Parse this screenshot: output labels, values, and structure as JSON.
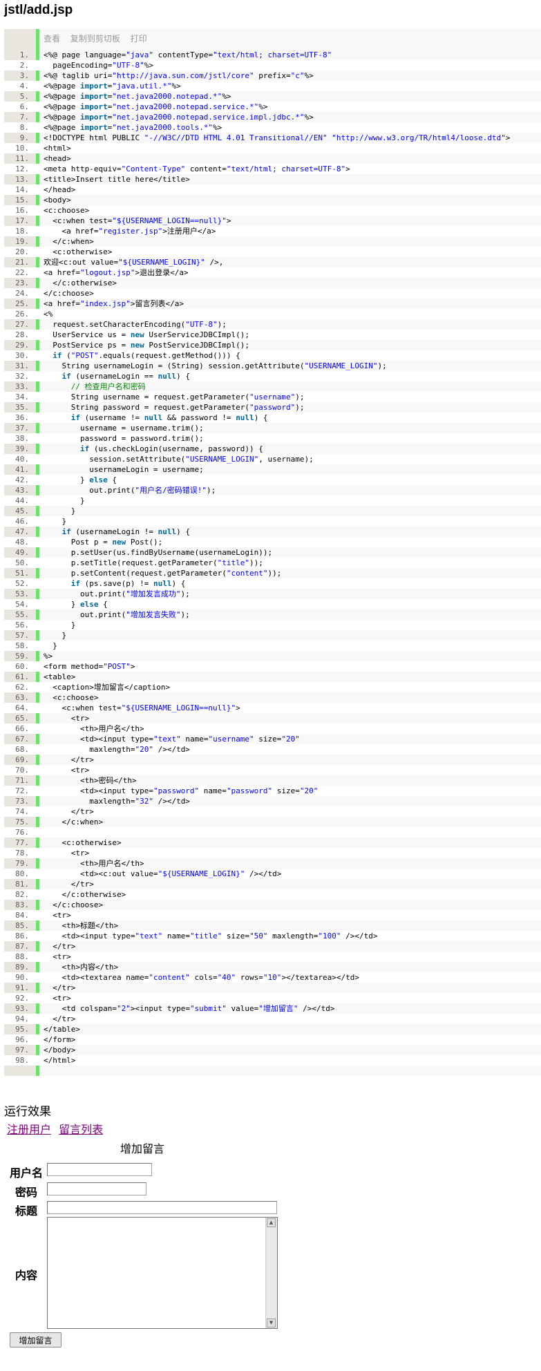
{
  "page_title": "jstl/add.jsp",
  "toolbar": {
    "view": "查看",
    "copy": "复制到剪切板",
    "print": "打印"
  },
  "code_lines": [
    "<%@ page language=\"java\" contentType=\"text/html; charset=UTF-8\"",
    "  pageEncoding=\"UTF-8\"%>",
    "<%@ taglib uri=\"http://java.sun.com/jstl/core\" prefix=\"c\"%>",
    "<%@page import=\"java.util.*\"%>",
    "<%@page import=\"net.java2000.notepad.*\"%>",
    "<%@page import=\"net.java2000.notepad.service.*\"%>",
    "<%@page import=\"net.java2000.notepad.service.impl.jdbc.*\"%>",
    "<%@page import=\"net.java2000.tools.*\"%>",
    "<!DOCTYPE html PUBLIC \"-//W3C//DTD HTML 4.01 Transitional//EN\" \"http://www.w3.org/TR/html4/loose.dtd\">",
    "<html>",
    "<head>",
    "<meta http-equiv=\"Content-Type\" content=\"text/html; charset=UTF-8\">",
    "<title>Insert title here</title>",
    "</head>",
    "<body>",
    "<c:choose>",
    "  <c:when test=\"${USERNAME_LOGIN==null}\">",
    "    <a href=\"register.jsp\">注册用户</a>",
    "  </c:when>",
    "  <c:otherwise>",
    "欢迎<c:out value=\"${USERNAME_LOGIN}\" />,",
    "<a href=\"logout.jsp\">退出登录</a>",
    "  </c:otherwise>",
    "</c:choose>",
    "<a href=\"index.jsp\">留言列表</a>",
    "<%",
    "  request.setCharacterEncoding(\"UTF-8\");",
    "  UserService us = new UserServiceJDBCImpl();",
    "  PostService ps = new PostServiceJDBCImpl();",
    "  if (\"POST\".equals(request.getMethod())) {",
    "    String usernameLogin = (String) session.getAttribute(\"USERNAME_LOGIN\");",
    "    if (usernameLogin == null) {",
    "      // 检查用户名和密码",
    "      String username = request.getParameter(\"username\");",
    "      String password = request.getParameter(\"password\");",
    "      if (username != null && password != null) {",
    "        username = username.trim();",
    "        password = password.trim();",
    "        if (us.checkLogin(username, password)) {",
    "          session.setAttribute(\"USERNAME_LOGIN\", username);",
    "          usernameLogin = username;",
    "        } else {",
    "          out.print(\"用户名/密码错误!\");",
    "        }",
    "      }",
    "    }",
    "    if (usernameLogin != null) {",
    "      Post p = new Post();",
    "      p.setUser(us.findByUsername(usernameLogin));",
    "      p.setTitle(request.getParameter(\"title\"));",
    "      p.setContent(request.getParameter(\"content\"));",
    "      if (ps.save(p) != null) {",
    "        out.print(\"增加发言成功\");",
    "      } else {",
    "        out.print(\"增加发言失败\");",
    "      }",
    "    }",
    "  }",
    "%>",
    "<form method=\"POST\">",
    "<table>",
    "  <caption>增加留言</caption>",
    "  <c:choose>",
    "    <c:when test=\"${USERNAME_LOGIN==null}\">",
    "      <tr>",
    "        <th>用户名</th>",
    "        <td><input type=\"text\" name=\"username\" size=\"20\"",
    "          maxlength=\"20\" /></td>",
    "      </tr>",
    "      <tr>",
    "        <th>密码</th>",
    "        <td><input type=\"password\" name=\"password\" size=\"20\"",
    "          maxlength=\"32\" /></td>",
    "      </tr>",
    "    </c:when>",
    "",
    "    <c:otherwise>",
    "      <tr>",
    "        <th>用户名</th>",
    "        <td><c:out value=\"${USERNAME_LOGIN}\" /></td>",
    "      </tr>",
    "    </c:otherwise>",
    "  </c:choose>",
    "  <tr>",
    "    <th>标题</th>",
    "    <td><input type=\"text\" name=\"title\" size=\"50\" maxlength=\"100\" /></td>",
    "  </tr>",
    "  <tr>",
    "    <th>内容</th>",
    "    <td><textarea name=\"content\" cols=\"40\" rows=\"10\"></textarea></td>",
    "  </tr>",
    "  <tr>",
    "    <td colspan=\"2\"><input type=\"submit\" value=\"增加留言\" /></td>",
    "  </tr>",
    "</table>",
    "</form>",
    "</body>",
    "</html>"
  ],
  "result": {
    "heading": "运行效果",
    "links": {
      "register": "注册用户",
      "list": "留言列表"
    },
    "caption": "增加留言",
    "labels": {
      "username": "用户名",
      "password": "密码",
      "title": "标题",
      "content": "内容"
    },
    "submit": "增加留言"
  }
}
